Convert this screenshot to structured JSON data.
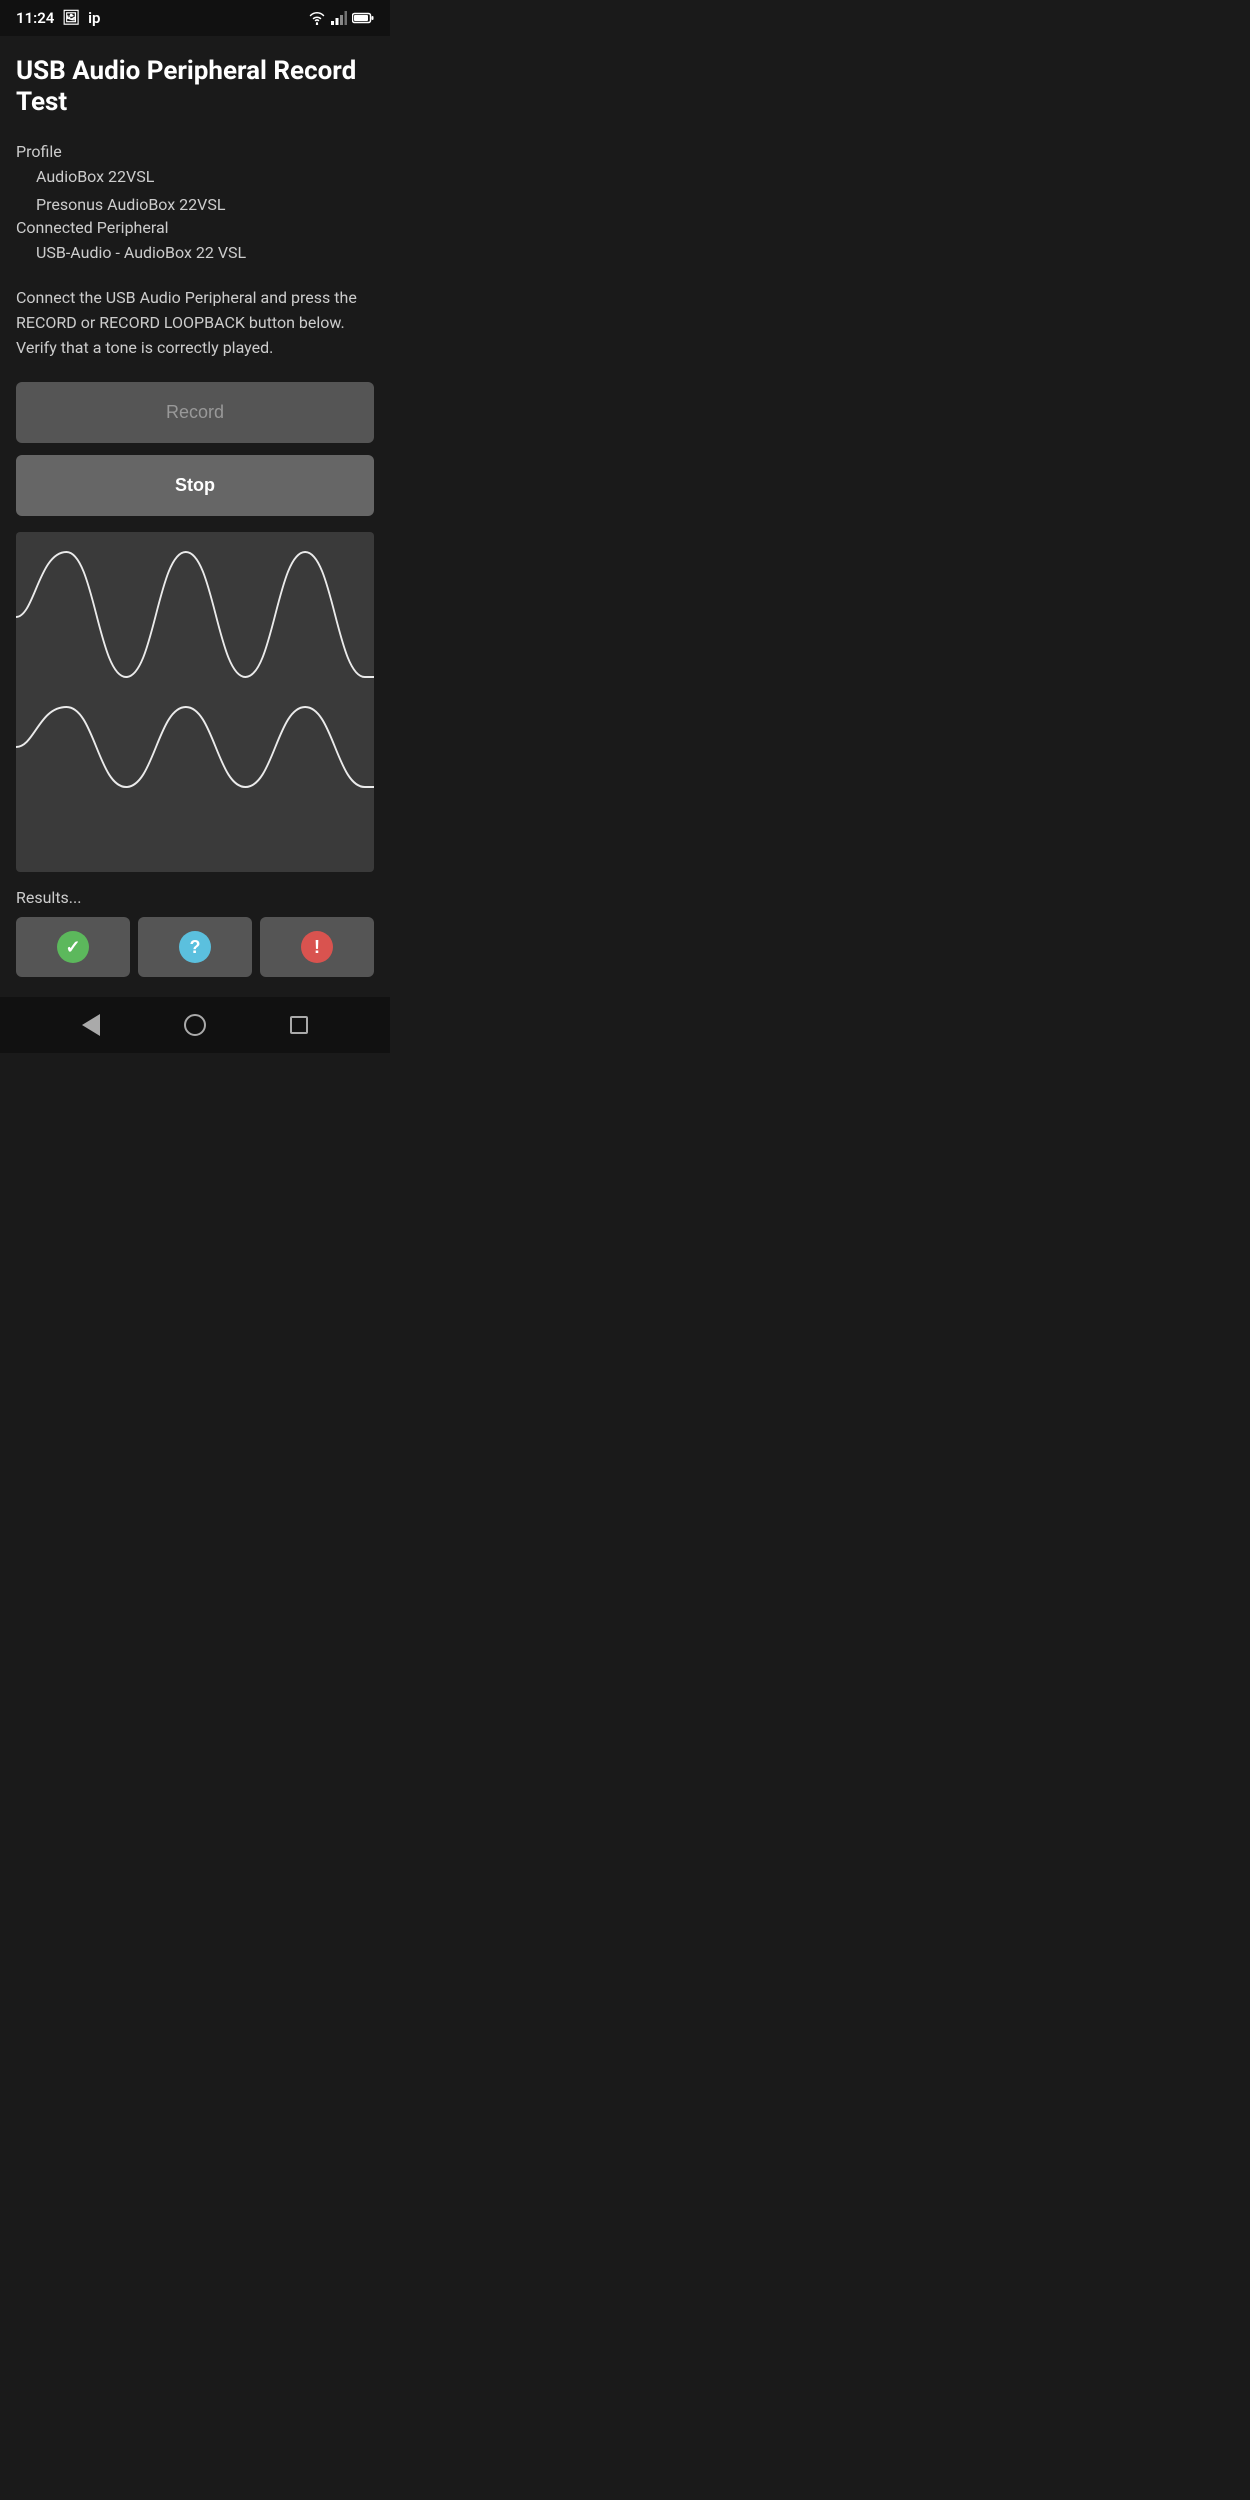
{
  "statusBar": {
    "time": "11:24",
    "icons": [
      "photo",
      "ip"
    ],
    "rightIcons": [
      "wifi",
      "signal",
      "battery"
    ]
  },
  "header": {
    "title": "USB Audio Peripheral Record Test"
  },
  "profile": {
    "label": "Profile",
    "name": "AudioBox 22VSL",
    "subname": "Presonus AudioBox 22VSL"
  },
  "peripheral": {
    "label": "Connected Peripheral",
    "name": "USB-Audio - AudioBox 22 VSL"
  },
  "instruction": {
    "text": "Connect the USB Audio Peripheral and press the RECORD or RECORD LOOPBACK button below. Verify that a tone is correctly played."
  },
  "buttons": {
    "record_label": "Record",
    "stop_label": "Stop"
  },
  "results": {
    "label": "Results...",
    "buttons": [
      {
        "icon": "check",
        "type": "success"
      },
      {
        "icon": "question",
        "type": "info"
      },
      {
        "icon": "exclaim",
        "type": "danger"
      }
    ]
  },
  "navBar": {
    "back": "back",
    "home": "home",
    "recent": "recent"
  }
}
